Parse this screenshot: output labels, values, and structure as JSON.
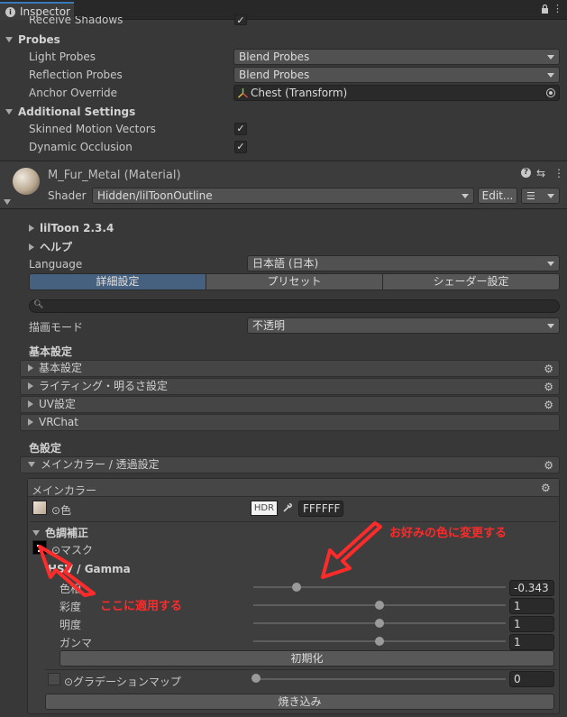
{
  "window": {
    "tab_title": "Inspector"
  },
  "renderer": {
    "receive_shadows_label": "Receive Shadows",
    "probes_header": "Probes",
    "light_probes_label": "Light Probes",
    "light_probes_value": "Blend Probes",
    "reflection_probes_label": "Reflection Probes",
    "reflection_probes_value": "Blend Probes",
    "anchor_override_label": "Anchor Override",
    "anchor_override_value": "Chest (Transform)",
    "additional_header": "Additional Settings",
    "skinned_motion_label": "Skinned Motion Vectors",
    "dynamic_occlusion_label": "Dynamic Occlusion",
    "check_glyph": "✓"
  },
  "material": {
    "name": "M_Fur_Metal (Material)",
    "shader_label": "Shader",
    "shader_value": "Hidden/lilToonOutline",
    "edit_label": "Edit..."
  },
  "liltoon": {
    "version": "lilToon 2.3.4",
    "help": "ヘルプ",
    "language_label": "Language",
    "language_value": "日本語 (日本)",
    "tabs": [
      "詳細設定",
      "プリセット",
      "シェーダー設定"
    ],
    "render_mode_label": "描画モード",
    "render_mode_value": "不透明",
    "basic_header": "基本設定",
    "basic_foldouts": [
      "基本設定",
      "ライティング・明るさ設定",
      "UV設定",
      "VRChat"
    ],
    "color_header": "色設定",
    "main_color_foldout": "メインカラー / 透過設定",
    "main_color_box": "メインカラー",
    "color_label": "⊙色",
    "hdr_label": "HDR",
    "color_hex": "FFFFFF",
    "color_correction_header": "色調補正",
    "mask_label": "⊙マスク",
    "hsv_header": "HSV / Gamma",
    "sliders": [
      {
        "label": "色相",
        "value": "-0.343",
        "fraction": 0.17
      },
      {
        "label": "彩度",
        "value": "1",
        "fraction": 0.5
      },
      {
        "label": "明度",
        "value": "1",
        "fraction": 0.5
      },
      {
        "label": "ガンマ",
        "value": "1",
        "fraction": 0.5
      }
    ],
    "reset_label": "初期化",
    "gradation_label": "⊙グラデーションマップ",
    "gradation_value": "0",
    "gradation_fraction": 0.0,
    "bake_label": "焼き込み"
  },
  "annotations": {
    "change_color": "お好みの色に変更する",
    "apply_here": "ここに適用する",
    "color": "#ff2a2a"
  }
}
